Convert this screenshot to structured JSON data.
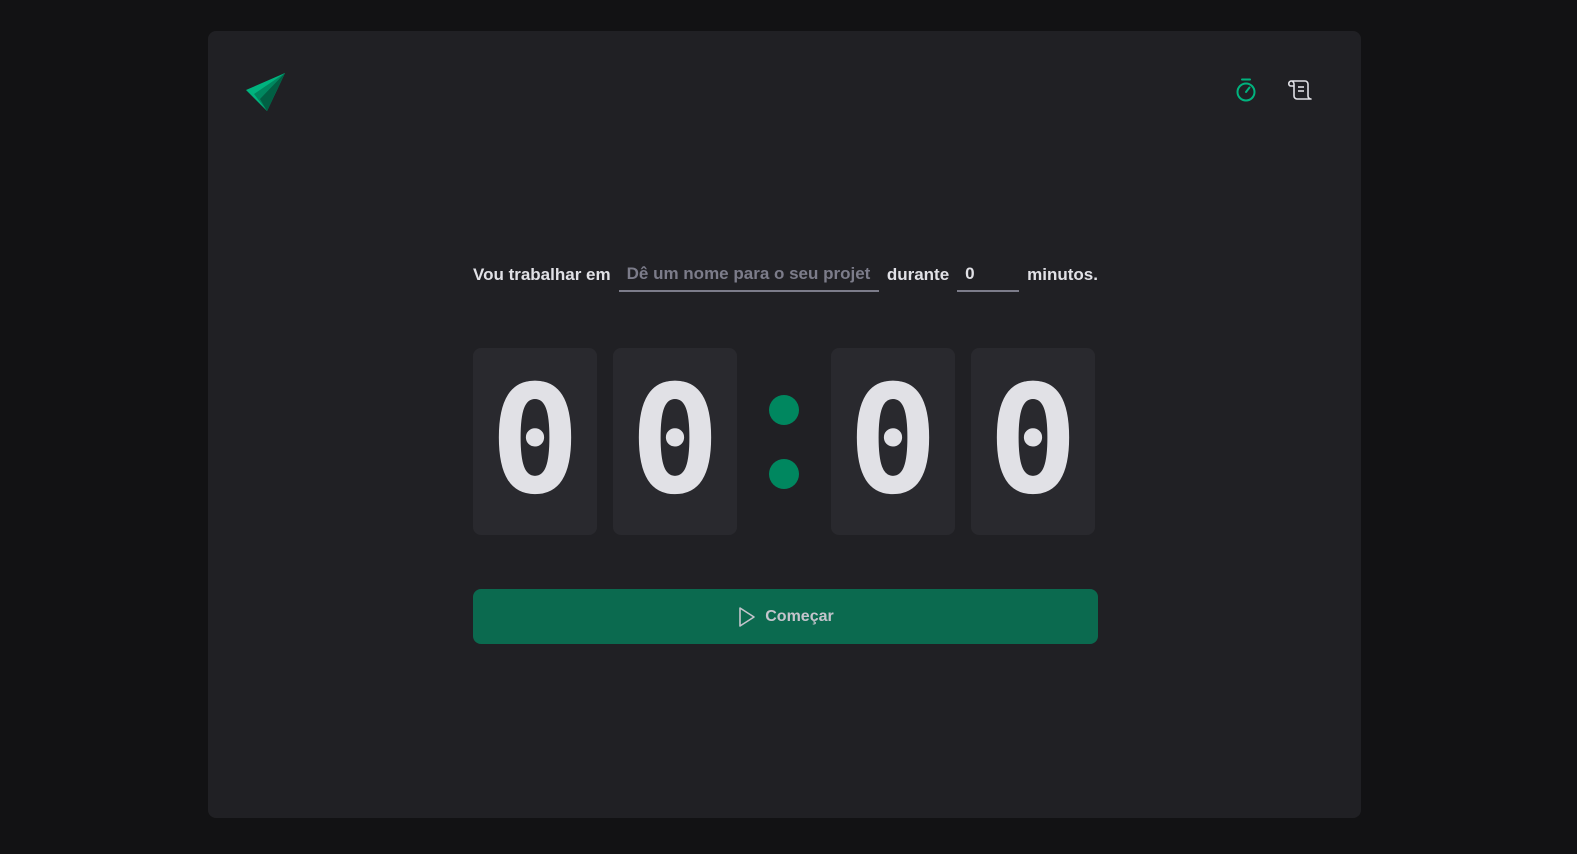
{
  "header": {
    "nav": [
      {
        "icon": "timer-icon",
        "active": true
      },
      {
        "icon": "scroll-icon",
        "active": false
      }
    ]
  },
  "form": {
    "label_prefix": "Vou trabalhar em",
    "task_placeholder": "Dê um nome para o seu projeto",
    "task_value": "",
    "label_middle": "durante",
    "minutes_value": "0",
    "label_suffix": "minutos."
  },
  "countdown": {
    "minutes_tens": "0",
    "minutes_ones": "0",
    "seconds_tens": "0",
    "seconds_ones": "0"
  },
  "start_button": {
    "label": "Começar",
    "icon": "play-icon"
  },
  "colors": {
    "background": "#121214",
    "card": "#202024",
    "digit_bg": "#29292e",
    "accent": "#00875f",
    "button": "#0b6a4f",
    "text": "#e1e1e6",
    "muted": "#7c7c8a"
  }
}
